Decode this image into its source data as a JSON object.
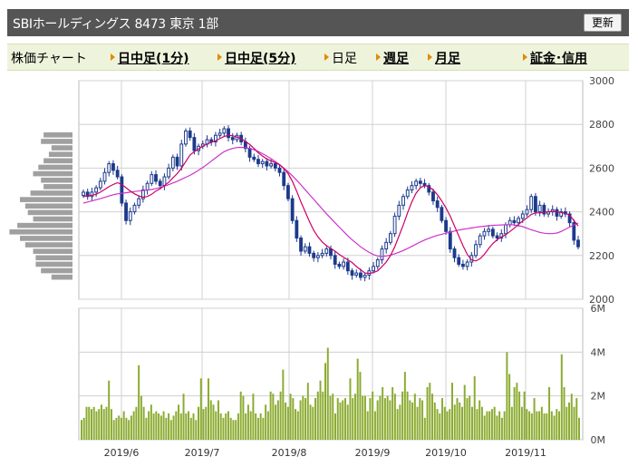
{
  "header": {
    "title": "SBIホールディングス  8473  東京 1部",
    "refresh_label": "更新"
  },
  "tabs": [
    {
      "label": "株価チャート",
      "link": false
    },
    {
      "label": "日中足(1分)",
      "link": true
    },
    {
      "label": "日中足(5分)",
      "link": true
    },
    {
      "label": "日足",
      "link": false
    },
    {
      "label": "週足",
      "link": true
    },
    {
      "label": "月足",
      "link": true
    },
    {
      "label": "証金･信用",
      "link": true
    }
  ],
  "colors": {
    "candle": "#1c3a8c",
    "ma_short": "#cc0066",
    "ma_long": "#cc33cc",
    "volume": "#8bab30",
    "profile": "#a0a0a0",
    "grid": "#d0d0d0",
    "accent_arrow": "#e38a00"
  },
  "chart_data": [
    {
      "type": "candlestick",
      "ylim": [
        2000,
        3000
      ],
      "yticks": [
        "2000",
        "2200",
        "2400",
        "2600",
        "2800",
        "3000"
      ],
      "xticks": [
        "2019/6",
        "2019/7",
        "2019/8",
        "2019/9",
        "2019/10",
        "2019/11"
      ],
      "closes": [
        2490,
        2470,
        2490,
        2510,
        2540,
        2580,
        2620,
        2590,
        2560,
        2440,
        2360,
        2400,
        2430,
        2460,
        2500,
        2530,
        2570,
        2540,
        2520,
        2560,
        2600,
        2650,
        2610,
        2710,
        2770,
        2740,
        2680,
        2700,
        2710,
        2730,
        2720,
        2750,
        2760,
        2780,
        2740,
        2730,
        2750,
        2720,
        2690,
        2650,
        2640,
        2620,
        2630,
        2610,
        2620,
        2600,
        2580,
        2520,
        2460,
        2360,
        2280,
        2220,
        2240,
        2210,
        2190,
        2200,
        2210,
        2230,
        2200,
        2160,
        2150,
        2170,
        2130,
        2110,
        2120,
        2100,
        2110,
        2130,
        2150,
        2180,
        2230,
        2260,
        2300,
        2380,
        2430,
        2470,
        2500,
        2520,
        2540,
        2530,
        2520,
        2490,
        2450,
        2420,
        2360,
        2310,
        2230,
        2190,
        2160,
        2150,
        2170,
        2200,
        2250,
        2290,
        2310,
        2320,
        2290,
        2280,
        2300,
        2340,
        2360,
        2350,
        2370,
        2390,
        2410,
        2470,
        2400,
        2430,
        2390,
        2400,
        2410,
        2380,
        2400,
        2390,
        2350,
        2270,
        2240
      ],
      "ma_short": [
        2470,
        2473,
        2476,
        2480,
        2490,
        2502,
        2515,
        2525,
        2533,
        2525,
        2510,
        2495,
        2482,
        2472,
        2467,
        2470,
        2480,
        2495,
        2505,
        2520,
        2535,
        2555,
        2575,
        2600,
        2630,
        2660,
        2675,
        2688,
        2700,
        2710,
        2718,
        2725,
        2735,
        2745,
        2750,
        2748,
        2742,
        2735,
        2722,
        2708,
        2690,
        2670,
        2655,
        2642,
        2633,
        2625,
        2615,
        2598,
        2575,
        2540,
        2495,
        2445,
        2400,
        2355,
        2315,
        2285,
        2262,
        2245,
        2232,
        2220,
        2205,
        2192,
        2180,
        2168,
        2150,
        2135,
        2120,
        2118,
        2122,
        2130,
        2150,
        2170,
        2200,
        2240,
        2290,
        2340,
        2395,
        2445,
        2485,
        2510,
        2520,
        2515,
        2500,
        2478,
        2450,
        2418,
        2380,
        2335,
        2290,
        2245,
        2205,
        2180,
        2175,
        2185,
        2205,
        2232,
        2255,
        2272,
        2285,
        2295,
        2310,
        2325,
        2342,
        2358,
        2372,
        2388,
        2395,
        2395,
        2398,
        2400,
        2402,
        2400,
        2397,
        2393,
        2385,
        2360,
        2335
      ],
      "ma_long": [
        2440,
        2445,
        2450,
        2455,
        2460,
        2466,
        2472,
        2478,
        2482,
        2485,
        2487,
        2490,
        2493,
        2495,
        2497,
        2499,
        2502,
        2506,
        2511,
        2517,
        2524,
        2532,
        2540,
        2549,
        2558,
        2567,
        2578,
        2590,
        2603,
        2617,
        2632,
        2647,
        2662,
        2675,
        2684,
        2690,
        2694,
        2695,
        2694,
        2690,
        2684,
        2676,
        2666,
        2655,
        2643,
        2630,
        2616,
        2600,
        2583,
        2565,
        2545,
        2523,
        2501,
        2479,
        2457,
        2435,
        2413,
        2391,
        2370,
        2350,
        2330,
        2310,
        2290,
        2272,
        2256,
        2240,
        2226,
        2214,
        2204,
        2198,
        2196,
        2198,
        2202,
        2208,
        2215,
        2223,
        2232,
        2242,
        2252,
        2262,
        2271,
        2279,
        2286,
        2292,
        2297,
        2302,
        2307,
        2312,
        2316,
        2320,
        2323,
        2326,
        2329,
        2332,
        2334,
        2336,
        2338,
        2339,
        2340,
        2341,
        2341,
        2340,
        2337,
        2332,
        2325,
        2318,
        2312,
        2306,
        2302,
        2300,
        2300,
        2303,
        2310,
        2320,
        2330,
        2340,
        2348
      ],
      "price_profile": [
        0.55,
        0.6,
        0.4,
        0.45,
        0.55,
        0.65,
        0.75,
        0.6,
        0.55,
        0.8,
        1.0,
        0.9,
        0.85,
        0.75,
        1.05,
        1.2,
        1.0,
        0.9,
        0.75,
        0.7,
        0.7,
        0.6,
        0.4
      ]
    },
    {
      "type": "bar",
      "ylim": [
        0,
        6
      ],
      "yticks": [
        "0M",
        "2M",
        "4M",
        "6M"
      ],
      "values": [
        0.9,
        1.0,
        1.5,
        1.5,
        1.4,
        1.5,
        1.3,
        1.4,
        1.6,
        1.4,
        1.5,
        2.7,
        1.4,
        0.9,
        1.0,
        1.1,
        1.0,
        1.3,
        1.0,
        0.9,
        1.1,
        1.3,
        1.5,
        3.4,
        2.0,
        1.5,
        1.0,
        1.3,
        1.6,
        1.2,
        1.3,
        1.2,
        1.1,
        1.3,
        1.0,
        1.2,
        0.9,
        1.1,
        1.3,
        1.6,
        1.2,
        2.1,
        1.2,
        1.3,
        1.0,
        1.2,
        0.9,
        1.5,
        2.8,
        1.4,
        1.5,
        2.8,
        1.8,
        1.6,
        1.3,
        1.8,
        1.2,
        1.0,
        1.2,
        1.3,
        1.0,
        0.9,
        0.9,
        1.2,
        2.2,
        2.0,
        1.2,
        1.6,
        1.3,
        2.1,
        1.2,
        1.0,
        1.2,
        1.0,
        1.6,
        1.3,
        2.2,
        2.1,
        1.6,
        1.8,
        2.2,
        3.2,
        1.7,
        1.5,
        2.1,
        1.9,
        1.4,
        1.3,
        1.8,
        2.0,
        1.9,
        2.6,
        1.6,
        1.5,
        1.9,
        2.2,
        2.7,
        2.2,
        3.5,
        4.2,
        2.0,
        2.1,
        1.2,
        1.9,
        1.7,
        1.8,
        1.9,
        1.6,
        2.8,
        1.9,
        2.1,
        3.7,
        3.1,
        2.0,
        2.0,
        1.3,
        1.9,
        2.2,
        1.3,
        1.8,
        2.0,
        2.4,
        1.9,
        2.0,
        1.8,
        2.4,
        2.1,
        1.4,
        1.6,
        2.2,
        3.1,
        2.2,
        1.8,
        1.7,
        2.1,
        1.5,
        1.9,
        1.8,
        1.0,
        2.4,
        2.6,
        2.1,
        1.7,
        1.4,
        1.2,
        1.9,
        1.5,
        1.3,
        1.4,
        2.6,
        1.6,
        1.9,
        1.7,
        1.5,
        2.5,
        1.9,
        2.0,
        1.5,
        2.9,
        1.4,
        1.8,
        1.5,
        1.1,
        1.3,
        1.3,
        1.4,
        1.5,
        1.1,
        1.3,
        1.0,
        1.3,
        4.0,
        3.0,
        1.5,
        2.4,
        2.6,
        2.2,
        1.5,
        2.2,
        1.4,
        1.3,
        1.2,
        1.9,
        1.3,
        1.3,
        1.5,
        1.2,
        1.2,
        2.4,
        1.3,
        1.1,
        1.4,
        1.3,
        3.9,
        2.4,
        1.5,
        1.7,
        2.1,
        1.5,
        1.9,
        1.0
      ]
    }
  ]
}
